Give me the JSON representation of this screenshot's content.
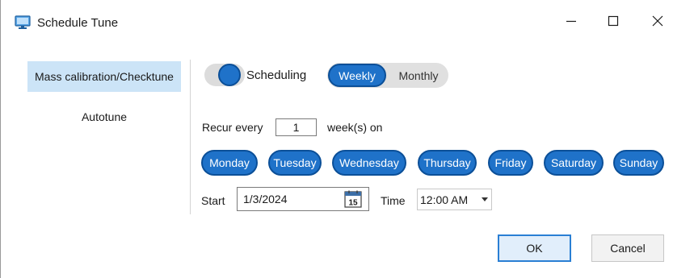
{
  "window": {
    "title": "Schedule Tune",
    "app_icon": "monitor-icon",
    "minimize_icon": "minimize-icon",
    "maximize_icon": "maximize-icon",
    "close_icon": "close-icon"
  },
  "sidebar": {
    "items": [
      {
        "label": "Mass calibration/Checktune",
        "selected": true
      },
      {
        "label": "Autotune",
        "selected": false
      }
    ]
  },
  "scheduling": {
    "toggle_label": "Scheduling",
    "enabled": true,
    "frequency_options": [
      {
        "label": "Weekly",
        "selected": true
      },
      {
        "label": "Monthly",
        "selected": false
      }
    ]
  },
  "recur": {
    "prefix": "Recur every",
    "value": "1",
    "suffix": "week(s) on"
  },
  "days": [
    {
      "label": "Monday",
      "selected": true
    },
    {
      "label": "Tuesday",
      "selected": true
    },
    {
      "label": "Wednesday",
      "selected": true
    },
    {
      "label": "Thursday",
      "selected": true
    },
    {
      "label": "Friday",
      "selected": true
    },
    {
      "label": "Saturday",
      "selected": true
    },
    {
      "label": "Sunday",
      "selected": true
    }
  ],
  "start": {
    "label": "Start",
    "date": "1/3/2024",
    "calendar_day": "15",
    "calendar_icon": "calendar-icon"
  },
  "time": {
    "label": "Time",
    "value": "12:00 AM"
  },
  "buttons": {
    "ok": "OK",
    "cancel": "Cancel"
  },
  "colors": {
    "accent": "#1f72c9",
    "accent_border": "#0b4f98",
    "nav_selected": "#cce4f7",
    "ok_border": "#2a7fd4"
  }
}
